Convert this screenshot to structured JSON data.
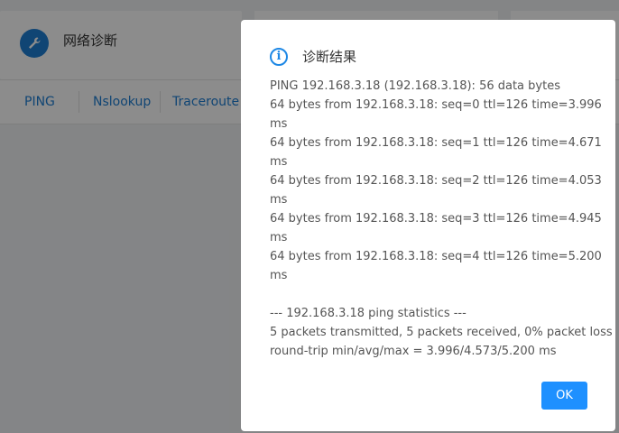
{
  "page": {
    "card_title": "网络诊断",
    "tabs": [
      "PING",
      "Nslookup",
      "Traceroute"
    ]
  },
  "dialog": {
    "title": "诊断结果",
    "lines": [
      "PING 192.168.3.18 (192.168.3.18): 56 data bytes",
      "64 bytes from 192.168.3.18: seq=0 ttl=126 time=3.996",
      "ms",
      "64 bytes from 192.168.3.18: seq=1 ttl=126 time=4.671",
      "ms",
      "64 bytes from 192.168.3.18: seq=2 ttl=126 time=4.053",
      "ms",
      "64 bytes from 192.168.3.18: seq=3 ttl=126 time=4.945",
      "ms",
      "64 bytes from 192.168.3.18: seq=4 ttl=126 time=5.200",
      "ms",
      "",
      "--- 192.168.3.18 ping statistics ---",
      "5 packets transmitted, 5 packets received, 0% packet loss",
      "round-trip min/avg/max = 3.996/4.573/5.200 ms"
    ],
    "ok_label": "OK"
  },
  "colors": {
    "accent": "#1e7ed4",
    "ok_button": "#1e90ff",
    "info_icon": "#1e88e5"
  },
  "icons": {
    "tool": "wrench-icon",
    "info": "info-icon"
  }
}
